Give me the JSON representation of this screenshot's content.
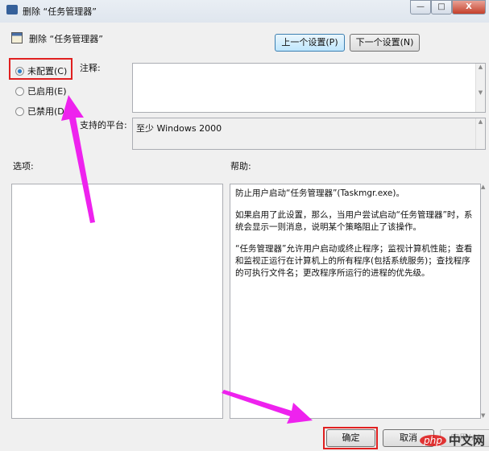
{
  "window": {
    "title": "删除 “任务管理器”",
    "minimize": "—",
    "maximize": "□",
    "close": "X"
  },
  "header": {
    "title": "删除 “任务管理器”",
    "prev_button": "上一个设置(P)",
    "next_button": "下一个设置(N)"
  },
  "state": {
    "options": [
      {
        "label": "未配置(C)",
        "selected": true
      },
      {
        "label": "已启用(E)",
        "selected": false
      },
      {
        "label": "已禁用(D)",
        "selected": false
      }
    ]
  },
  "comment": {
    "label": "注释:",
    "value": ""
  },
  "platform": {
    "label": "支持的平台:",
    "value": "至少 Windows 2000"
  },
  "options_label": "选项:",
  "help": {
    "label": "帮助:",
    "paragraphs": [
      "防止用户启动“任务管理器”(Taskmgr.exe)。",
      "如果启用了此设置，那么，当用户尝试启动“任务管理器”时，系统会显示一则消息，说明某个策略阻止了该操作。",
      "“任务管理器”允许用户启动或终止程序；监视计算机性能；查看和监视正运行在计算机上的所有程序(包括系统服务)；查找程序的可执行文件名；更改程序所运行的进程的优先级。"
    ]
  },
  "footer": {
    "ok": "确定",
    "cancel": "取消",
    "apply": "应用(A)"
  },
  "watermark": "php中文网",
  "colors": {
    "highlight": "#e02020",
    "arrow": "#ee22ee"
  }
}
